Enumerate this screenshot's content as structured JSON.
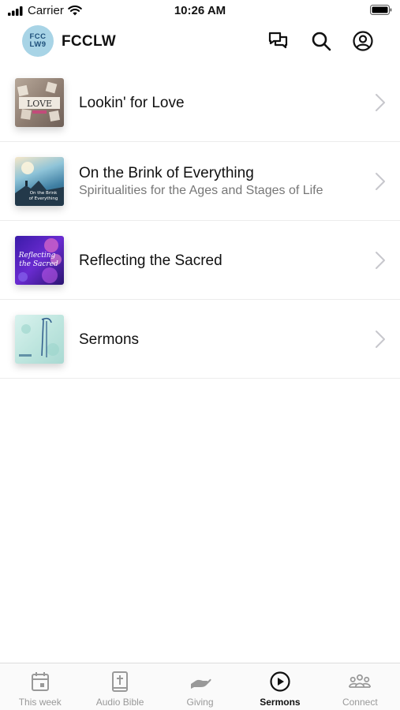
{
  "status_bar": {
    "carrier": "Carrier",
    "time": "10:26 AM"
  },
  "header": {
    "logo_text": "FCC LW9",
    "title": "FCCLW",
    "icons": [
      "chat-icon",
      "search-icon",
      "account-icon"
    ]
  },
  "sermon_series": [
    {
      "title": "Lookin' for Love",
      "subtitle": "",
      "thumb_text": "LOVE"
    },
    {
      "title": "On the Brink of Everything",
      "subtitle": "Spiritualities for the Ages and Stages of Life",
      "thumb_text": "On the Brink of Everything"
    },
    {
      "title": "Reflecting the Sacred",
      "subtitle": "",
      "thumb_text": "Reflecting the Sacred"
    },
    {
      "title": "Sermons",
      "subtitle": "",
      "thumb_text": ""
    }
  ],
  "tabs": [
    {
      "label": "This week",
      "icon": "calendar-icon",
      "active": false
    },
    {
      "label": "Audio Bible",
      "icon": "bible-icon",
      "active": false
    },
    {
      "label": "Giving",
      "icon": "giving-hand-icon",
      "active": false
    },
    {
      "label": "Sermons",
      "icon": "play-circle-icon",
      "active": true
    },
    {
      "label": "Connect",
      "icon": "people-icon",
      "active": false
    }
  ],
  "colors": {
    "active_tab": "#111111",
    "inactive_tab": "#999999",
    "logo_bg": "#a8d4e6",
    "subtitle": "#777777"
  }
}
